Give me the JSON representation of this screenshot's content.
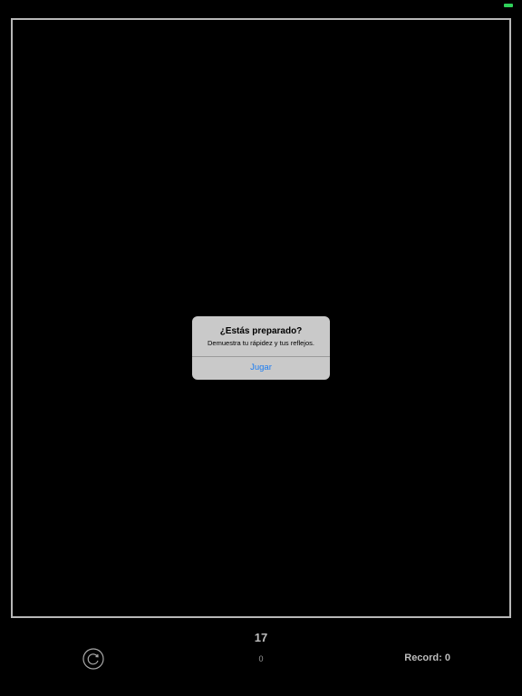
{
  "alert": {
    "title": "¿Estás preparado?",
    "message": "Demuestra tu rápidez y tus reflejos.",
    "button_label": "Jugar"
  },
  "hud": {
    "timer": "17",
    "score": "0",
    "record_label": "Record:",
    "record_value": "0",
    "restart_icon": "restart-icon"
  },
  "colors": {
    "background": "#000000",
    "border": "#b8b8b8",
    "alert_bg": "#c9c9c9",
    "accent_blue": "#1a7cf3",
    "battery_green": "#2fd15a"
  }
}
